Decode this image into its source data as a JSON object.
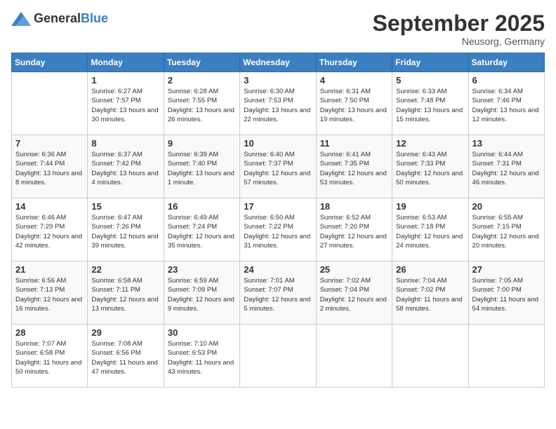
{
  "logo": {
    "general": "General",
    "blue": "Blue"
  },
  "title": "September 2025",
  "location": "Neusorg, Germany",
  "header_days": [
    "Sunday",
    "Monday",
    "Tuesday",
    "Wednesday",
    "Thursday",
    "Friday",
    "Saturday"
  ],
  "weeks": [
    [
      {
        "day": "",
        "sunrise": "",
        "sunset": "",
        "daylight": ""
      },
      {
        "day": "1",
        "sunrise": "Sunrise: 6:27 AM",
        "sunset": "Sunset: 7:57 PM",
        "daylight": "Daylight: 13 hours and 30 minutes."
      },
      {
        "day": "2",
        "sunrise": "Sunrise: 6:28 AM",
        "sunset": "Sunset: 7:55 PM",
        "daylight": "Daylight: 13 hours and 26 minutes."
      },
      {
        "day": "3",
        "sunrise": "Sunrise: 6:30 AM",
        "sunset": "Sunset: 7:53 PM",
        "daylight": "Daylight: 13 hours and 22 minutes."
      },
      {
        "day": "4",
        "sunrise": "Sunrise: 6:31 AM",
        "sunset": "Sunset: 7:50 PM",
        "daylight": "Daylight: 13 hours and 19 minutes."
      },
      {
        "day": "5",
        "sunrise": "Sunrise: 6:33 AM",
        "sunset": "Sunset: 7:48 PM",
        "daylight": "Daylight: 13 hours and 15 minutes."
      },
      {
        "day": "6",
        "sunrise": "Sunrise: 6:34 AM",
        "sunset": "Sunset: 7:46 PM",
        "daylight": "Daylight: 13 hours and 12 minutes."
      }
    ],
    [
      {
        "day": "7",
        "sunrise": "Sunrise: 6:36 AM",
        "sunset": "Sunset: 7:44 PM",
        "daylight": "Daylight: 13 hours and 8 minutes."
      },
      {
        "day": "8",
        "sunrise": "Sunrise: 6:37 AM",
        "sunset": "Sunset: 7:42 PM",
        "daylight": "Daylight: 13 hours and 4 minutes."
      },
      {
        "day": "9",
        "sunrise": "Sunrise: 6:39 AM",
        "sunset": "Sunset: 7:40 PM",
        "daylight": "Daylight: 13 hours and 1 minute."
      },
      {
        "day": "10",
        "sunrise": "Sunrise: 6:40 AM",
        "sunset": "Sunset: 7:37 PM",
        "daylight": "Daylight: 12 hours and 57 minutes."
      },
      {
        "day": "11",
        "sunrise": "Sunrise: 6:41 AM",
        "sunset": "Sunset: 7:35 PM",
        "daylight": "Daylight: 12 hours and 53 minutes."
      },
      {
        "day": "12",
        "sunrise": "Sunrise: 6:43 AM",
        "sunset": "Sunset: 7:33 PM",
        "daylight": "Daylight: 12 hours and 50 minutes."
      },
      {
        "day": "13",
        "sunrise": "Sunrise: 6:44 AM",
        "sunset": "Sunset: 7:31 PM",
        "daylight": "Daylight: 12 hours and 46 minutes."
      }
    ],
    [
      {
        "day": "14",
        "sunrise": "Sunrise: 6:46 AM",
        "sunset": "Sunset: 7:29 PM",
        "daylight": "Daylight: 12 hours and 42 minutes."
      },
      {
        "day": "15",
        "sunrise": "Sunrise: 6:47 AM",
        "sunset": "Sunset: 7:26 PM",
        "daylight": "Daylight: 12 hours and 39 minutes."
      },
      {
        "day": "16",
        "sunrise": "Sunrise: 6:49 AM",
        "sunset": "Sunset: 7:24 PM",
        "daylight": "Daylight: 12 hours and 35 minutes."
      },
      {
        "day": "17",
        "sunrise": "Sunrise: 6:50 AM",
        "sunset": "Sunset: 7:22 PM",
        "daylight": "Daylight: 12 hours and 31 minutes."
      },
      {
        "day": "18",
        "sunrise": "Sunrise: 6:52 AM",
        "sunset": "Sunset: 7:20 PM",
        "daylight": "Daylight: 12 hours and 27 minutes."
      },
      {
        "day": "19",
        "sunrise": "Sunrise: 6:53 AM",
        "sunset": "Sunset: 7:18 PM",
        "daylight": "Daylight: 12 hours and 24 minutes."
      },
      {
        "day": "20",
        "sunrise": "Sunrise: 6:55 AM",
        "sunset": "Sunset: 7:15 PM",
        "daylight": "Daylight: 12 hours and 20 minutes."
      }
    ],
    [
      {
        "day": "21",
        "sunrise": "Sunrise: 6:56 AM",
        "sunset": "Sunset: 7:13 PM",
        "daylight": "Daylight: 12 hours and 16 minutes."
      },
      {
        "day": "22",
        "sunrise": "Sunrise: 6:58 AM",
        "sunset": "Sunset: 7:11 PM",
        "daylight": "Daylight: 12 hours and 13 minutes."
      },
      {
        "day": "23",
        "sunrise": "Sunrise: 6:59 AM",
        "sunset": "Sunset: 7:09 PM",
        "daylight": "Daylight: 12 hours and 9 minutes."
      },
      {
        "day": "24",
        "sunrise": "Sunrise: 7:01 AM",
        "sunset": "Sunset: 7:07 PM",
        "daylight": "Daylight: 12 hours and 5 minutes."
      },
      {
        "day": "25",
        "sunrise": "Sunrise: 7:02 AM",
        "sunset": "Sunset: 7:04 PM",
        "daylight": "Daylight: 12 hours and 2 minutes."
      },
      {
        "day": "26",
        "sunrise": "Sunrise: 7:04 AM",
        "sunset": "Sunset: 7:02 PM",
        "daylight": "Daylight: 11 hours and 58 minutes."
      },
      {
        "day": "27",
        "sunrise": "Sunrise: 7:05 AM",
        "sunset": "Sunset: 7:00 PM",
        "daylight": "Daylight: 11 hours and 54 minutes."
      }
    ],
    [
      {
        "day": "28",
        "sunrise": "Sunrise: 7:07 AM",
        "sunset": "Sunset: 6:58 PM",
        "daylight": "Daylight: 11 hours and 50 minutes."
      },
      {
        "day": "29",
        "sunrise": "Sunrise: 7:08 AM",
        "sunset": "Sunset: 6:56 PM",
        "daylight": "Daylight: 11 hours and 47 minutes."
      },
      {
        "day": "30",
        "sunrise": "Sunrise: 7:10 AM",
        "sunset": "Sunset: 6:53 PM",
        "daylight": "Daylight: 11 hours and 43 minutes."
      },
      {
        "day": "",
        "sunrise": "",
        "sunset": "",
        "daylight": ""
      },
      {
        "day": "",
        "sunrise": "",
        "sunset": "",
        "daylight": ""
      },
      {
        "day": "",
        "sunrise": "",
        "sunset": "",
        "daylight": ""
      },
      {
        "day": "",
        "sunrise": "",
        "sunset": "",
        "daylight": ""
      }
    ]
  ]
}
